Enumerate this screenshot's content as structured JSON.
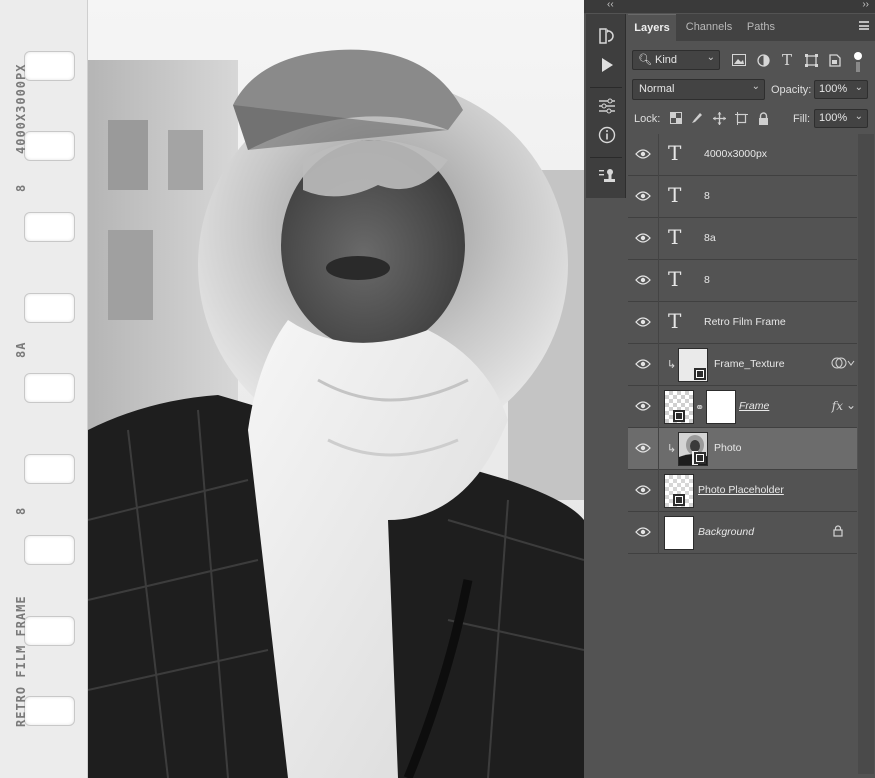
{
  "canvas": {
    "edge_labels": [
      "4000X3000PX",
      "8",
      "8A",
      "8",
      "RETRO FILM FRAME"
    ],
    "sprocket_count": 9
  },
  "panel": {
    "collapse_left": "‹‹",
    "collapse_right": "››",
    "tabs": [
      {
        "label": "Layers",
        "active": true
      },
      {
        "label": "Channels",
        "active": false
      },
      {
        "label": "Paths",
        "active": false
      }
    ],
    "filter": {
      "kind_label": "Kind"
    },
    "blend_mode": "Normal",
    "opacity_label": "Opacity:",
    "opacity_value": "100%",
    "lock_label": "Lock:",
    "fill_label": "Fill:",
    "fill_value": "100%"
  },
  "layers": [
    {
      "name": "4000x3000px",
      "kind": "text"
    },
    {
      "name": "8",
      "kind": "text"
    },
    {
      "name": "8a",
      "kind": "text"
    },
    {
      "name": "8",
      "kind": "text"
    },
    {
      "name": "Retro Film Frame",
      "kind": "text"
    },
    {
      "name": "Frame_Texture",
      "kind": "smart-clipped"
    },
    {
      "name": "Frame",
      "kind": "masked-fx",
      "fx_label": "fx"
    },
    {
      "name": "Photo",
      "kind": "photo-clipped",
      "selected": true
    },
    {
      "name": "Photo Placeholder",
      "kind": "placeholder"
    },
    {
      "name": "Background",
      "kind": "background",
      "locked": true
    }
  ],
  "colors": {
    "panel_bg": "#535353",
    "selected_row": "#6c6c6c",
    "tab_bar": "#424242",
    "film_strip": "#ececec"
  }
}
